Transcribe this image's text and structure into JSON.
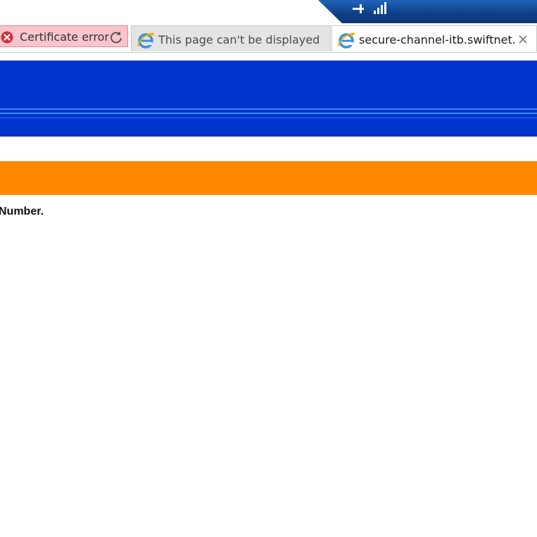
{
  "window": {
    "pin_icon": "pin-icon",
    "signal_icon": "signal-strength-icon",
    "accent_color": "#0d3f86"
  },
  "address_bar": {
    "certificate_error_label": "Certificate error",
    "error_icon": "error-x-icon",
    "refresh_icon": "refresh-icon",
    "error_bg_color": "#f9c5cc"
  },
  "tabs": [
    {
      "label": "This page can't be displayed",
      "icon": "ie-icon",
      "active": false
    },
    {
      "label": "secure-channel-itb.swiftnet....",
      "icon": "ie-icon",
      "active": true,
      "close_icon": "close-icon"
    }
  ],
  "page": {
    "header_color": "#0033cc",
    "banner_color": "#ff8800",
    "body_text": "Number."
  }
}
